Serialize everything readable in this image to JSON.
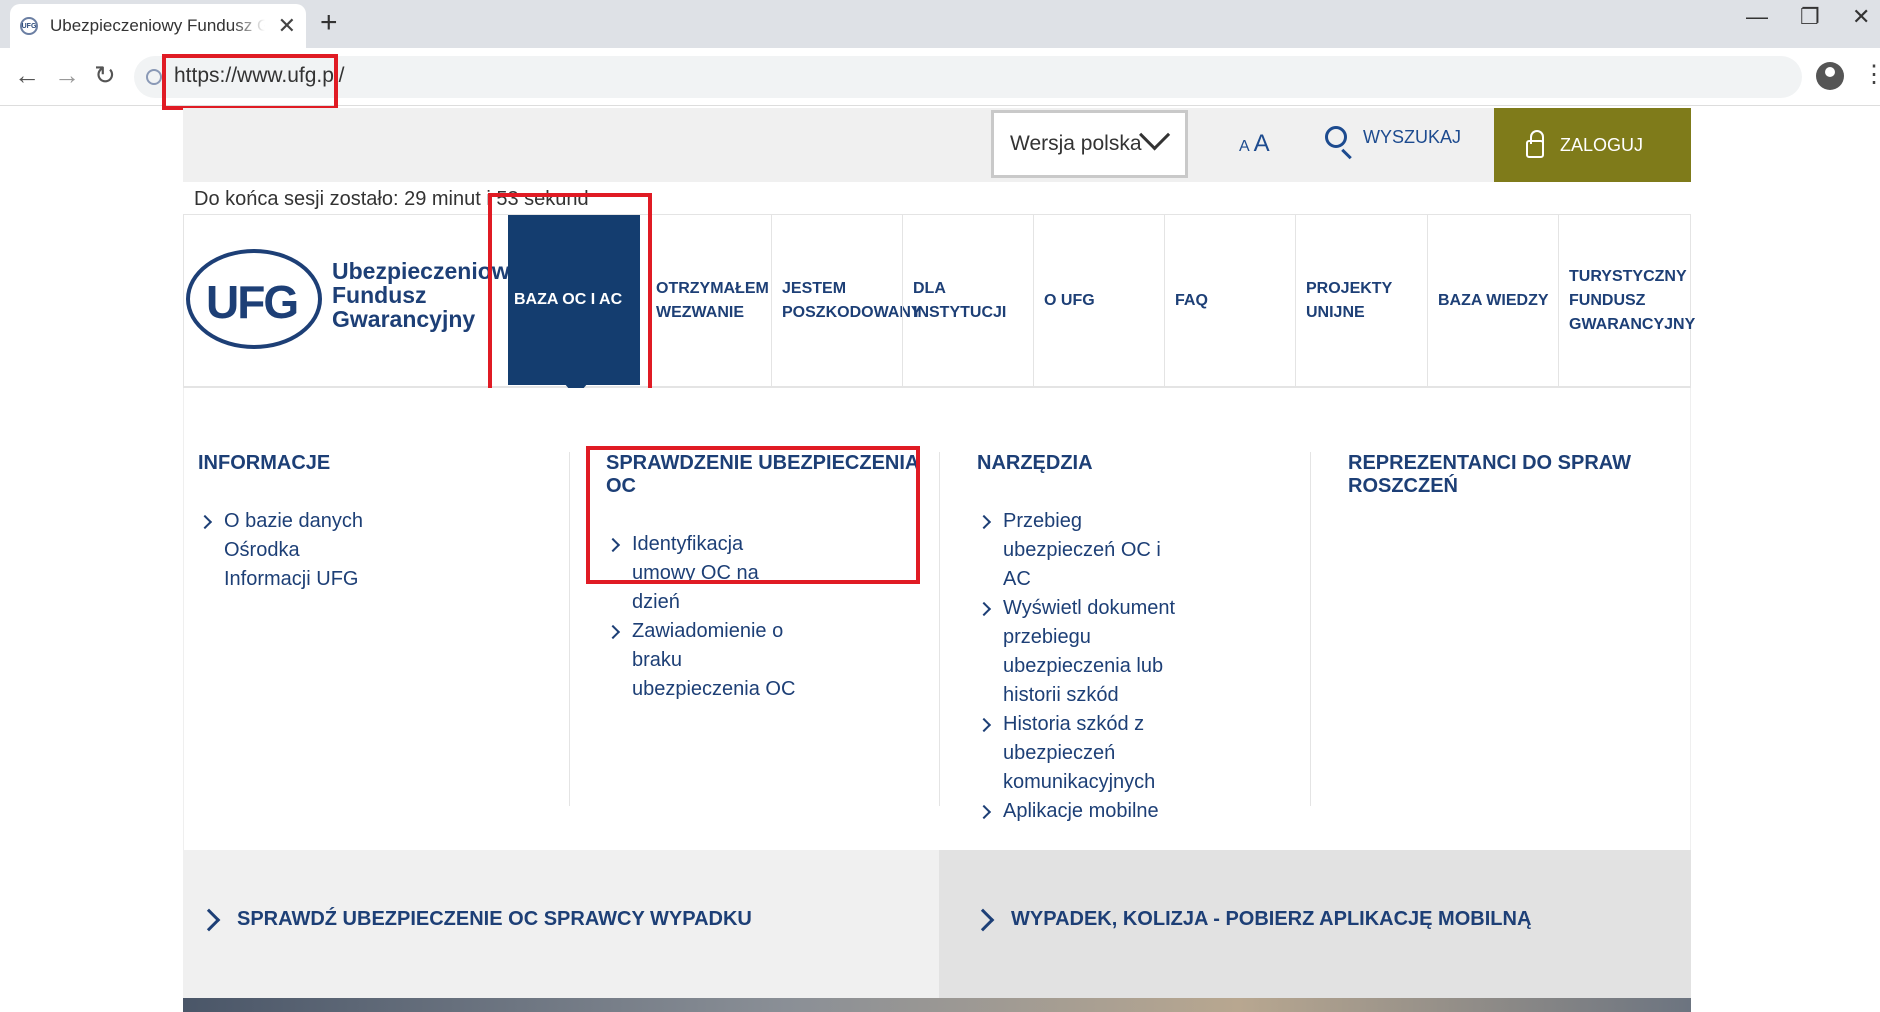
{
  "browser": {
    "tab_title": "Ubezpieczeniowy Fundusz Gwarancyjny",
    "favicon_text": "UFG",
    "tab_close": "✕",
    "new_tab": "+",
    "url": "https://www.ufg.pl/",
    "back": "←",
    "forward": "→",
    "reload": "↻",
    "minimize": "—",
    "restore": "❐",
    "close": "✕",
    "menu": "⋮"
  },
  "utility": {
    "language": "Wersja polska",
    "font_small": "A",
    "font_large": "A",
    "search_label": "WYSZUKAJ",
    "login_label": "ZALOGUJ",
    "login_color": "#7f7b1a"
  },
  "session_text": "Do końca sesji zostało: 29 minut i 53 sekund",
  "logo": {
    "mark": "UFG",
    "line1": "Ubezpieczeniowy",
    "line2": "Fundusz",
    "line3": "Gwarancyjny"
  },
  "nav": {
    "active": "BAZA OC I AC",
    "active_color": "#143d6f",
    "items": [
      {
        "line1": "OTRZYMAŁEM",
        "line2": "WEZWANIE"
      },
      {
        "line1": "JESTEM",
        "line2": "POSZKODOWANY"
      },
      {
        "line1": "DLA",
        "line2": "INSTYTUCJI"
      },
      {
        "line1": "O UFG",
        "line2": ""
      },
      {
        "line1": "FAQ",
        "line2": ""
      },
      {
        "line1": "PROJEKTY",
        "line2": "UNIJNE"
      },
      {
        "line1": "BAZA WIEDZY",
        "line2": ""
      },
      {
        "line1": "TURYSTYCZNY",
        "line2": "FUNDUSZ",
        "line3": "GWARANCYJNY"
      }
    ]
  },
  "menu": {
    "col1": {
      "title": "INFORMACJE",
      "items": [
        "O bazie danych Ośrodka Informacji UFG"
      ]
    },
    "col2": {
      "title": "SPRAWDZENIE UBEZPIECZENIA OC",
      "items": [
        "Identyfikacja umowy OC na dzień",
        "Zawiadomienie o braku ubezpieczenia OC"
      ]
    },
    "col3": {
      "title": "NARZĘDZIA",
      "items": [
        "Przebieg ubezpieczeń OC i AC",
        "Wyświetl dokument przebiegu ubezpieczenia lub historii szkód",
        "Historia szkód z ubezpieczeń komunikacyjnych",
        "Aplikacje mobilne"
      ]
    },
    "col4": {
      "title": "REPREZENTANCI DO SPRAW ROSZCZEŃ",
      "items": []
    }
  },
  "promo": {
    "left": "SPRAWDŹ UBEZPIECZENIE OC SPRAWCY WYPADKU",
    "right": "WYPADEK, KOLIZJA - POBIERZ APLIKACJĘ MOBILNĄ"
  },
  "colors": {
    "brand_navy": "#1d3f76",
    "highlight_red": "#e01b24"
  }
}
